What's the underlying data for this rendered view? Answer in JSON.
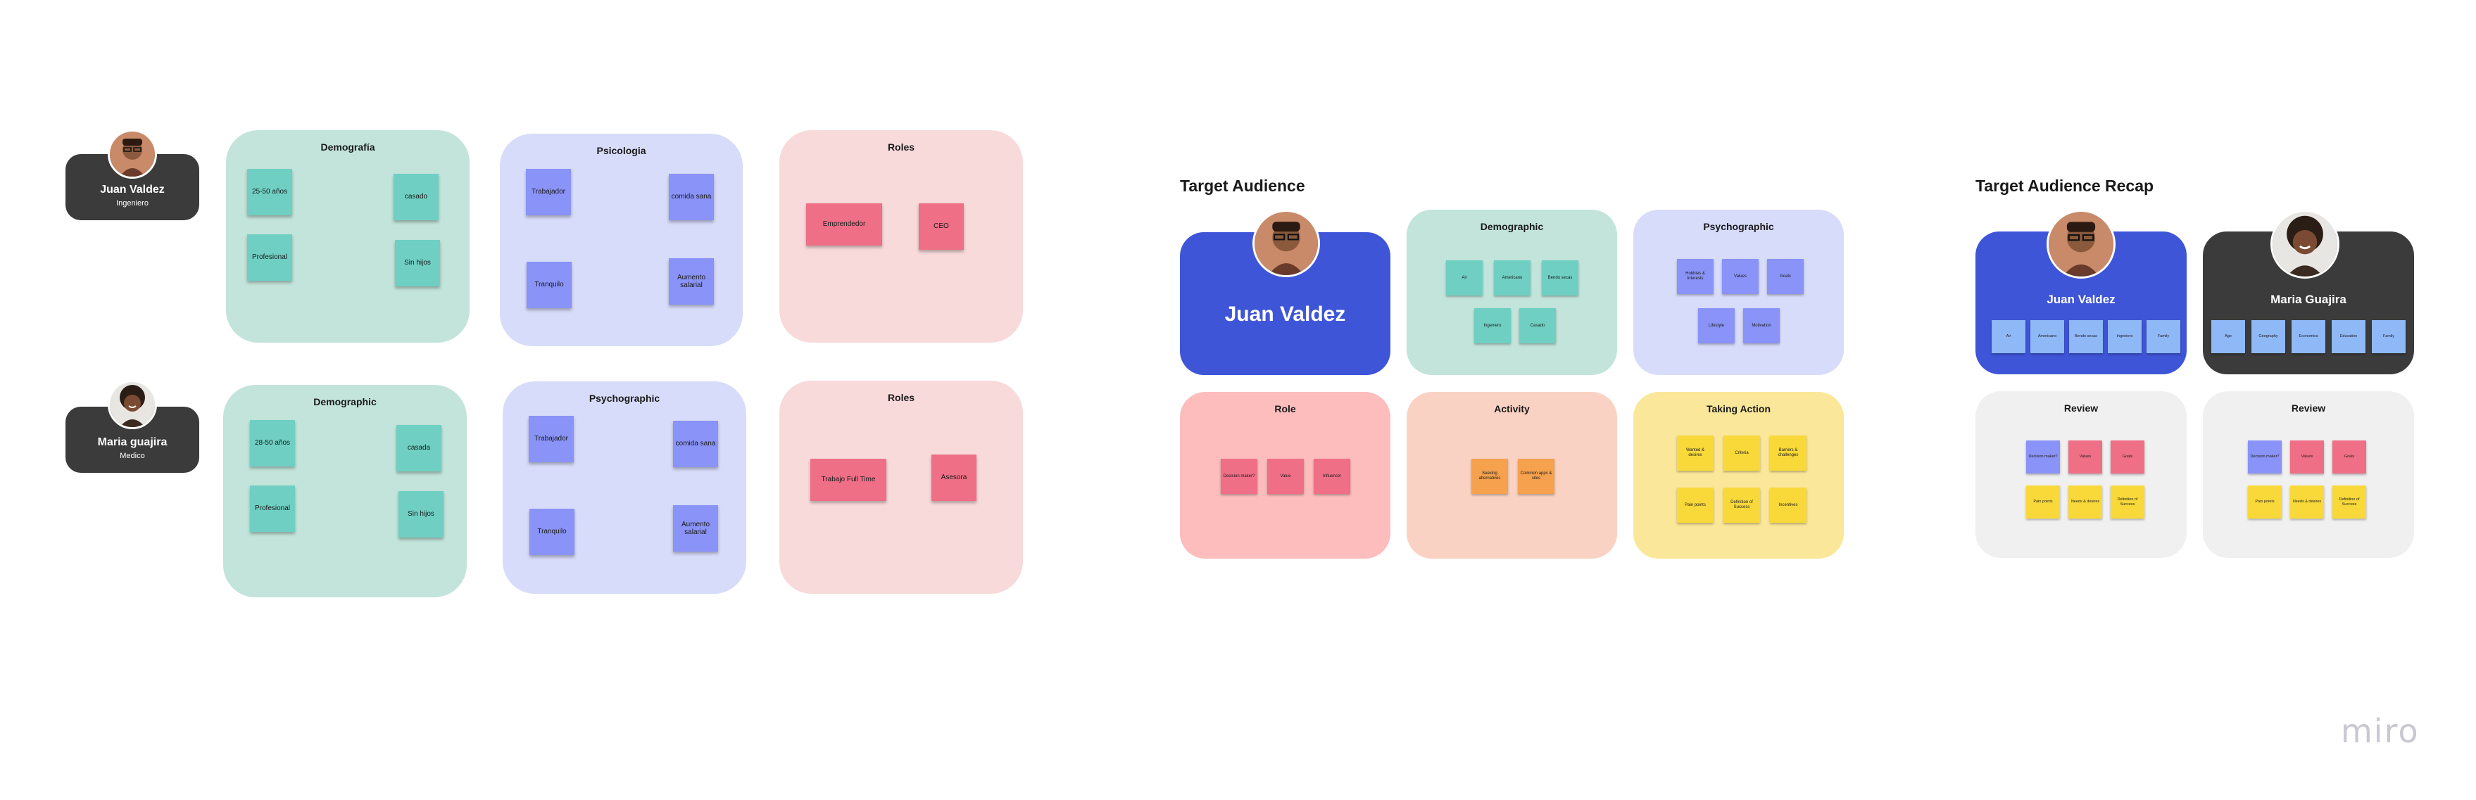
{
  "left_personas": [
    {
      "name": "Juan Valdez",
      "role": "Ingeniero"
    },
    {
      "name": "Maria guajira",
      "role": "Medico"
    }
  ],
  "row1": {
    "demografia": {
      "title": "Demografía",
      "stickies": [
        "25-50 años",
        "casado",
        "Profesional",
        "Sin hijos"
      ]
    },
    "psicologia": {
      "title": "Psicologia",
      "stickies": [
        "Trabajador",
        "comida sana",
        "Tranquilo",
        "Aumento salarial"
      ]
    },
    "roles": {
      "title": "Roles",
      "stickies": [
        "Emprendedor",
        "CEO"
      ]
    }
  },
  "row2": {
    "demographic": {
      "title": "Demographic",
      "stickies": [
        "28-50 años",
        "casada",
        "Profesional",
        "Sin hijos"
      ]
    },
    "psychographic": {
      "title": "Psychographic",
      "stickies": [
        "Trabajador",
        "comida sana",
        "Tranquilo",
        "Aumento salarial"
      ]
    },
    "roles": {
      "title": "Roles",
      "stickies": [
        "Trabajo Full Time",
        "Asesora"
      ]
    }
  },
  "target": {
    "title": "Target Audience",
    "persona_name": "Juan Valdez",
    "demographic": {
      "title": "Demographic",
      "stickies": [
        "Air",
        "Americano",
        "Bendo secas",
        "Ingeniero",
        "Casado"
      ]
    },
    "psychographic": {
      "title": "Psychographic",
      "stickies": [
        "Hobbies & Interests",
        "Values",
        "Goals",
        "Lifestyle",
        "Motivation"
      ]
    },
    "role": {
      "title": "Role",
      "stickies": [
        "Decision maker?",
        "Value",
        "Influencer"
      ]
    },
    "activity": {
      "title": "Activity",
      "stickies": [
        "Seeking alternatives",
        "Common apps & sites"
      ]
    },
    "taking_action": {
      "title": "Taking Action",
      "stickies": [
        "Wanted & desires",
        "Criteria",
        "Barriers & challenges",
        "Pain points",
        "Definition of Success",
        "Incentives"
      ]
    }
  },
  "recap": {
    "title": "Target Audience Recap",
    "juan": {
      "name": "Juan Valdez",
      "stickies": [
        "Air",
        "Americano",
        "Bendo secas",
        "Ingeniero",
        "Family"
      ]
    },
    "maria": {
      "name": "Maria Guajira",
      "stickies": [
        "Age",
        "Geography",
        "Economics",
        "Education",
        "Family"
      ]
    },
    "review1": {
      "title": "Review",
      "stickies": [
        "Decision maker?",
        "Values",
        "Goals",
        "Pain points",
        "Needs & desires",
        "Definition of Success"
      ]
    },
    "review2": {
      "title": "Review",
      "stickies": [
        "Decision maker?",
        "Values",
        "Goals",
        "Pain points",
        "Needs & desires",
        "Definition of Success"
      ]
    }
  },
  "brand": {
    "logo": "miro"
  },
  "colors": {
    "teal_panel": "#c3e4da",
    "blue_panel": "#d7dcfa",
    "pink_panel": "#f8dadb",
    "persona_dark": "#3b3b3b",
    "persona_blue": "#3f55d8",
    "role_panel": "#fdbdbd",
    "activity_panel": "#fad2c3",
    "action_panel": "#fbe79a",
    "review_panel": "#f0f0f0"
  },
  "icons": [
    "avatar-juan",
    "avatar-maria",
    "miro-logo"
  ]
}
